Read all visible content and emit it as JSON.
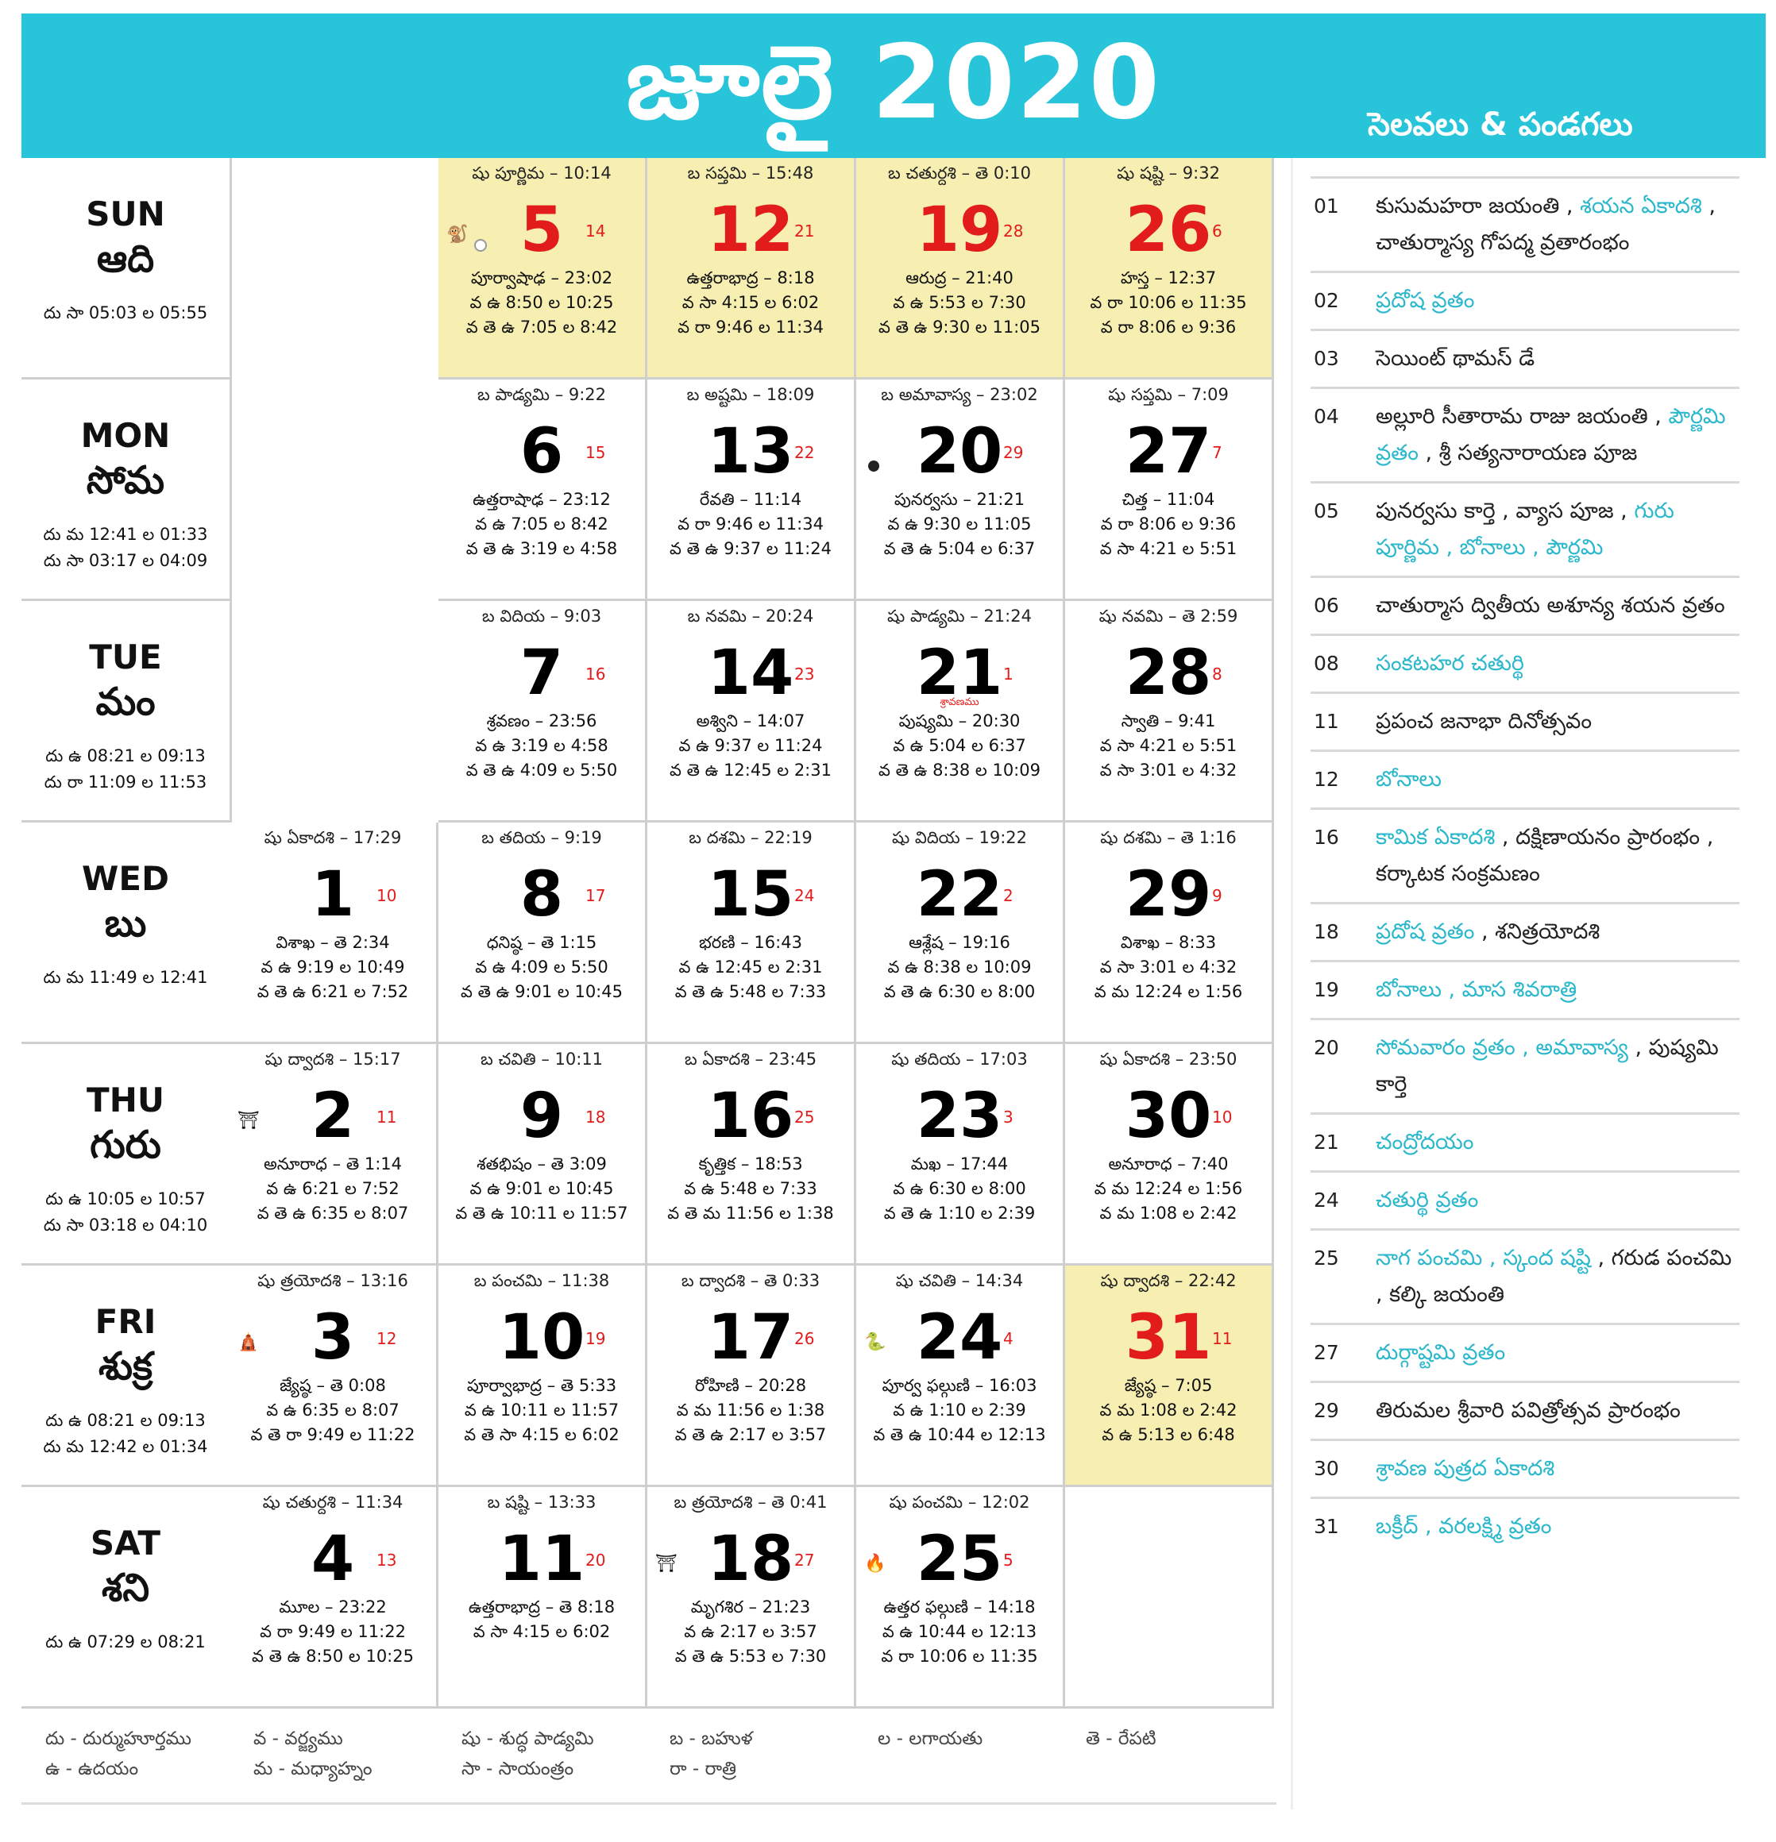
{
  "header": {
    "title": "జూలై 2020",
    "subtitle": "సెలవలు & పండగలు"
  },
  "days": [
    {
      "en": "SUN",
      "te": "ఆది",
      "t1": "దు సా 05:03 ల 05:55",
      "t2": ""
    },
    {
      "en": "MON",
      "te": "సోమ",
      "t1": "దు మ 12:41 ల 01:33",
      "t2": "దు సా 03:17 ల 04:09"
    },
    {
      "en": "TUE",
      "te": "మం",
      "t1": "దు ఉ 08:21 ల 09:13",
      "t2": "దు రా 11:09 ల 11:53"
    },
    {
      "en": "WED",
      "te": "బు",
      "t1": "దు మ 11:49 ల 12:41",
      "t2": ""
    },
    {
      "en": "THU",
      "te": "గురు",
      "t1": "దు ఉ 10:05 ల 10:57",
      "t2": "దు సా 03:18 ల 04:10"
    },
    {
      "en": "FRI",
      "te": "శుక్ర",
      "t1": "దు ఉ 08:21 ల 09:13",
      "t2": "దు మ 12:42 ల 01:34"
    },
    {
      "en": "SAT",
      "te": "శని",
      "t1": "దు ఉ 07:29 ల 08:21",
      "t2": ""
    }
  ],
  "cells": [
    {
      "day": "5",
      "lunar": "14",
      "tithi": "షు పూర్ణిమ – 10:14",
      "l1": "పూర్వాషాఢ – 23:02",
      "l2": "వ ఉ 8:50 ల 10:25",
      "l3": "వ తె ఉ 7:05 ల 8:42",
      "mini": "",
      "icon": "🐒",
      "dot": "○"
    },
    {
      "day": "12",
      "lunar": "21",
      "tithi": "బ సప్తమి – 15:48",
      "l1": "ఉత్తరాభాద్ర – 8:18",
      "l2": "వ సా 4:15 ల 6:02",
      "l3": "వ రా 9:46 ల 11:34",
      "mini": "",
      "icon": "",
      "dot": ""
    },
    {
      "day": "19",
      "lunar": "28",
      "tithi": "బ చతుర్దశి – తె 0:10",
      "l1": "ఆరుద్ర – 21:40",
      "l2": "వ ఉ 5:53 ల 7:30",
      "l3": "వ తె ఉ 9:30 ల 11:05",
      "mini": "",
      "icon": "",
      "dot": ""
    },
    {
      "day": "26",
      "lunar": "6",
      "tithi": "షు షష్టి – 9:32",
      "l1": "హస్త – 12:37",
      "l2": "వ రా 10:06 ల 11:35",
      "l3": "వ రా 8:06 ల 9:36",
      "mini": "",
      "icon": "",
      "dot": ""
    },
    {
      "day": "6",
      "lunar": "15",
      "tithi": "బ పాడ్యమి – 9:22",
      "l1": "ఉత్తరాషాఢ – 23:12",
      "l2": "వ ఉ 7:05 ల 8:42",
      "l3": "వ తె ఉ 3:19 ల 4:58",
      "mini": "",
      "icon": "",
      "dot": ""
    },
    {
      "day": "13",
      "lunar": "22",
      "tithi": "బ అష్టమి – 18:09",
      "l1": "రేవతి – 11:14",
      "l2": "వ రా 9:46 ల 11:34",
      "l3": "వ తె ఉ 9:37 ల 11:24",
      "mini": "",
      "icon": "",
      "dot": ""
    },
    {
      "day": "20",
      "lunar": "29",
      "tithi": "బ అమావాస్య – 23:02",
      "l1": "పునర్వసు – 21:21",
      "l2": "వ ఉ 9:30 ల 11:05",
      "l3": "వ తె ఉ 5:04 ల 6:37",
      "mini": "",
      "icon": "",
      "dot": "●"
    },
    {
      "day": "27",
      "lunar": "7",
      "tithi": "షు సప్తమి – 7:09",
      "l1": "చిత్త – 11:04",
      "l2": "వ రా 8:06 ల 9:36",
      "l3": "వ సా 4:21 ల 5:51",
      "mini": "",
      "icon": "",
      "dot": ""
    },
    {
      "day": "7",
      "lunar": "16",
      "tithi": "బ విదియ – 9:03",
      "l1": "శ్రవణం – 23:56",
      "l2": "వ ఉ 3:19 ల 4:58",
      "l3": "వ తె ఉ 4:09 ల 5:50",
      "mini": "",
      "icon": "",
      "dot": ""
    },
    {
      "day": "14",
      "lunar": "23",
      "tithi": "బ నవమి – 20:24",
      "l1": "అశ్విని – 14:07",
      "l2": "వ ఉ 9:37 ల 11:24",
      "l3": "వ తె ఉ 12:45 ల 2:31",
      "mini": "",
      "icon": "",
      "dot": ""
    },
    {
      "day": "21",
      "lunar": "1",
      "tithi": "షు పాడ్యమి – 21:24",
      "l1": "పుష్యమి – 20:30",
      "l2": "వ ఉ 5:04 ల 6:37",
      "l3": "వ తె ఉ 8:38 ల 10:09",
      "mini": "శ్రావణము",
      "icon": "",
      "dot": ""
    },
    {
      "day": "28",
      "lunar": "8",
      "tithi": "షు నవమి – తె 2:59",
      "l1": "స్వాతి – 9:41",
      "l2": "వ సా 4:21 ల 5:51",
      "l3": "వ సా 3:01 ల 4:32",
      "mini": "",
      "icon": "",
      "dot": ""
    },
    {
      "day": "1",
      "lunar": "10",
      "tithi": "షు ఏకాదశి – 17:29",
      "l1": "విశాఖ – తె 2:34",
      "l2": "వ ఉ 9:19 ల 10:49",
      "l3": "వ తె ఉ 6:21 ల 7:52",
      "mini": "",
      "icon": "",
      "dot": ""
    },
    {
      "day": "8",
      "lunar": "17",
      "tithi": "బ తదియ – 9:19",
      "l1": "ధనిష్ఠ – తె 1:15",
      "l2": "వ ఉ 4:09 ల 5:50",
      "l3": "వ తె ఉ 9:01 ల 10:45",
      "mini": "",
      "icon": "",
      "dot": ""
    },
    {
      "day": "15",
      "lunar": "24",
      "tithi": "బ దశమి – 22:19",
      "l1": "భరణి – 16:43",
      "l2": "వ ఉ 12:45 ల 2:31",
      "l3": "వ తె ఉ 5:48 ల 7:33",
      "mini": "",
      "icon": "",
      "dot": ""
    },
    {
      "day": "22",
      "lunar": "2",
      "tithi": "షు విదియ – 19:22",
      "l1": "ఆశ్లేష – 19:16",
      "l2": "వ ఉ 8:38 ల 10:09",
      "l3": "వ తె ఉ 6:30 ల 8:00",
      "mini": "",
      "icon": "",
      "dot": ""
    },
    {
      "day": "29",
      "lunar": "9",
      "tithi": "షు దశమి – తె 1:16",
      "l1": "విశాఖ – 8:33",
      "l2": "వ సా 3:01 ల 4:32",
      "l3": "వ మ 12:24 ల 1:56",
      "mini": "",
      "icon": "",
      "dot": ""
    },
    {
      "day": "2",
      "lunar": "11",
      "tithi": "షు ద్వాదశి – 15:17",
      "l1": "అనూరాధ – తె 1:14",
      "l2": "వ ఉ 6:21 ల 7:52",
      "l3": "వ తె ఉ 6:35 ల 8:07",
      "mini": "",
      "icon": "⛩",
      "dot": ""
    },
    {
      "day": "9",
      "lunar": "18",
      "tithi": "బ చవితి – 10:11",
      "l1": "శతభిషం – తె 3:09",
      "l2": "వ ఉ 9:01 ల 10:45",
      "l3": "వ తె ఉ 10:11 ల 11:57",
      "mini": "",
      "icon": "",
      "dot": ""
    },
    {
      "day": "16",
      "lunar": "25",
      "tithi": "బ ఏకాదశి – 23:45",
      "l1": "కృత్తిక – 18:53",
      "l2": "వ ఉ 5:48 ల 7:33",
      "l3": "వ తె మ 11:56 ల 1:38",
      "mini": "",
      "icon": "",
      "dot": ""
    },
    {
      "day": "23",
      "lunar": "3",
      "tithi": "షు తదియ – 17:03",
      "l1": "మఖ – 17:44",
      "l2": "వ ఉ 6:30 ల 8:00",
      "l3": "వ తె ఉ 1:10 ల 2:39",
      "mini": "",
      "icon": "",
      "dot": ""
    },
    {
      "day": "30",
      "lunar": "10",
      "tithi": "షు ఏకాదశి – 23:50",
      "l1": "అనూరాధ – 7:40",
      "l2": "వ మ 12:24 ల 1:56",
      "l3": "వ మ 1:08 ల 2:42",
      "mini": "",
      "icon": "",
      "dot": ""
    },
    {
      "day": "3",
      "lunar": "12",
      "tithi": "షు త్రయోదశి – 13:16",
      "l1": "జ్యేష్ఠ – తె 0:08",
      "l2": "వ ఉ 6:35 ల 8:07",
      "l3": "వ తె రా 9:49 ల 11:22",
      "mini": "",
      "icon": "🛕",
      "dot": ""
    },
    {
      "day": "10",
      "lunar": "19",
      "tithi": "బ పంచమి – 11:38",
      "l1": "పూర్వాభాద్ర – తె 5:33",
      "l2": "వ ఉ 10:11 ల 11:57",
      "l3": "వ తె సా 4:15 ల 6:02",
      "mini": "",
      "icon": "",
      "dot": ""
    },
    {
      "day": "17",
      "lunar": "26",
      "tithi": "బ ద్వాదశి – తె 0:33",
      "l1": "రోహిణి – 20:28",
      "l2": "వ మ 11:56 ల 1:38",
      "l3": "వ తె ఉ 2:17 ల 3:57",
      "mini": "",
      "icon": "",
      "dot": ""
    },
    {
      "day": "24",
      "lunar": "4",
      "tithi": "షు చవితి – 14:34",
      "l1": "పూర్వ ఫల్గుణి – 16:03",
      "l2": "వ ఉ 1:10 ల 2:39",
      "l3": "వ తె ఉ 10:44 ల 12:13",
      "mini": "",
      "icon": "🐍",
      "dot": ""
    },
    {
      "day": "31",
      "lunar": "11",
      "tithi": "షు ద్వాదశి – 22:42",
      "l1": "జ్యేష్ఠ – 7:05",
      "l2": "వ మ 1:08 ల 2:42",
      "l3": "వ ఉ 5:13 ల 6:48",
      "mini": "",
      "icon": "",
      "dot": ""
    },
    {
      "day": "4",
      "lunar": "13",
      "tithi": "షు చతుర్దశి – 11:34",
      "l1": "మూల – 23:22",
      "l2": "వ రా 9:49 ల 11:22",
      "l3": "వ తె ఉ 8:50 ల 10:25",
      "mini": "",
      "icon": "",
      "dot": ""
    },
    {
      "day": "11",
      "lunar": "20",
      "tithi": "బ షష్టి – 13:33",
      "l1": "ఉత్తరాభాద్ర – తె 8:18",
      "l2": "వ సా 4:15 ల 6:02",
      "l3": "",
      "mini": "",
      "icon": "",
      "dot": ""
    },
    {
      "day": "18",
      "lunar": "27",
      "tithi": "బ త్రయోదశి – తె 0:41",
      "l1": "మృగశిర – 21:23",
      "l2": "వ ఉ 2:17 ల 3:57",
      "l3": "వ తె ఉ 5:53 ల 7:30",
      "mini": "",
      "icon": "⛩",
      "dot": ""
    },
    {
      "day": "25",
      "lunar": "5",
      "tithi": "షు పంచమి – 12:02",
      "l1": "ఉత్తర ఫల్గుణి – 14:18",
      "l2": "వ ఉ 10:44 ల 12:13",
      "l3": "వ రా 10:06 ల 11:35",
      "mini": "",
      "icon": "🔥",
      "dot": ""
    }
  ],
  "legend": [
    {
      "a": "దు - దుర్ముహూర్తము",
      "b": "ఉ - ఉదయం"
    },
    {
      "a": "వ - వర్జ్యము",
      "b": "మ - మధ్యాహ్నం"
    },
    {
      "a": "షు - శుద్ధ పాడ్యమి",
      "b": "సా - సాయంత్రం"
    },
    {
      "a": "బ - బహుళ",
      "b": "రా - రాత్రి"
    },
    {
      "a": "ల - లగాయతు",
      "b": ""
    },
    {
      "a": "తె - రేపటి",
      "b": ""
    }
  ],
  "holidays": [
    {
      "date": "01",
      "text": "కుసుమహరా జయంతి , ",
      "hl": "శయన ఏకాదశి",
      "text2": " , చాతుర్మాస్య గోపద్మ వ్రతారంభం"
    },
    {
      "date": "02",
      "text": "",
      "hl": "ప్రదోష వ్రతం",
      "text2": ""
    },
    {
      "date": "03",
      "text": "సెయింట్ థామస్ డే",
      "hl": "",
      "text2": ""
    },
    {
      "date": "04",
      "text": "అల్లూరి సీతారామ రాజు జయంతి , ",
      "hl": "పౌర్ణమి వ్రతం",
      "text2": " , శ్రీ సత్యనారాయణ పూజ"
    },
    {
      "date": "05",
      "text": "పునర్వసు కార్తె , వ్యాస పూజ , ",
      "hl": "గురు పూర్ణిమ , బోనాలు , పౌర్ణమి",
      "text2": ""
    },
    {
      "date": "06",
      "text": "చాతుర్మాస ద్వితీయ అశూన్య శయన వ్రతం",
      "hl": "",
      "text2": ""
    },
    {
      "date": "08",
      "text": "",
      "hl": "సంకటహర చతుర్థి",
      "text2": ""
    },
    {
      "date": "11",
      "text": "ప్రపంచ జనాభా దినోత్సవం",
      "hl": "",
      "text2": ""
    },
    {
      "date": "12",
      "text": "",
      "hl": "బోనాలు",
      "text2": ""
    },
    {
      "date": "16",
      "text": "",
      "hl": "కామిక ఏకాదశి",
      "text2": " , దక్షిణాయనం ప్రారంభం , కర్కాటక సంక్రమణం"
    },
    {
      "date": "18",
      "text": "",
      "hl": "ప్రదోష వ్రతం",
      "text2": " , శనిత్రయోదశి"
    },
    {
      "date": "19",
      "text": "",
      "hl": "బోనాలు , మాస శివరాత్రి",
      "text2": ""
    },
    {
      "date": "20",
      "text": "",
      "hl": "సోమవారం వ్రతం , అమావాస్య",
      "text2": " , పుష్యమి కార్తె"
    },
    {
      "date": "21",
      "text": "",
      "hl": "చంద్రోదయం",
      "text2": ""
    },
    {
      "date": "24",
      "text": "",
      "hl": "చతుర్థి వ్రతం",
      "text2": ""
    },
    {
      "date": "25",
      "text": "",
      "hl": "నాగ పంచమి , స్కంద షష్టి",
      "text2": " , గరుడ పంచమి , కల్కి జయంతి"
    },
    {
      "date": "27",
      "text": "",
      "hl": "దుర్గాష్టమి వ్రతం",
      "text2": ""
    },
    {
      "date": "29",
      "text": "తిరుమల శ్రీవారి పవిత్రోత్సవ ప్రారంభం",
      "hl": "",
      "text2": ""
    },
    {
      "date": "30",
      "text": "",
      "hl": "శ్రావణ పుత్రద ఏకాదశి",
      "text2": ""
    },
    {
      "date": "31",
      "text": "",
      "hl": "బక్రీద్ , వరలక్ష్మి వ్రతం",
      "text2": ""
    }
  ]
}
